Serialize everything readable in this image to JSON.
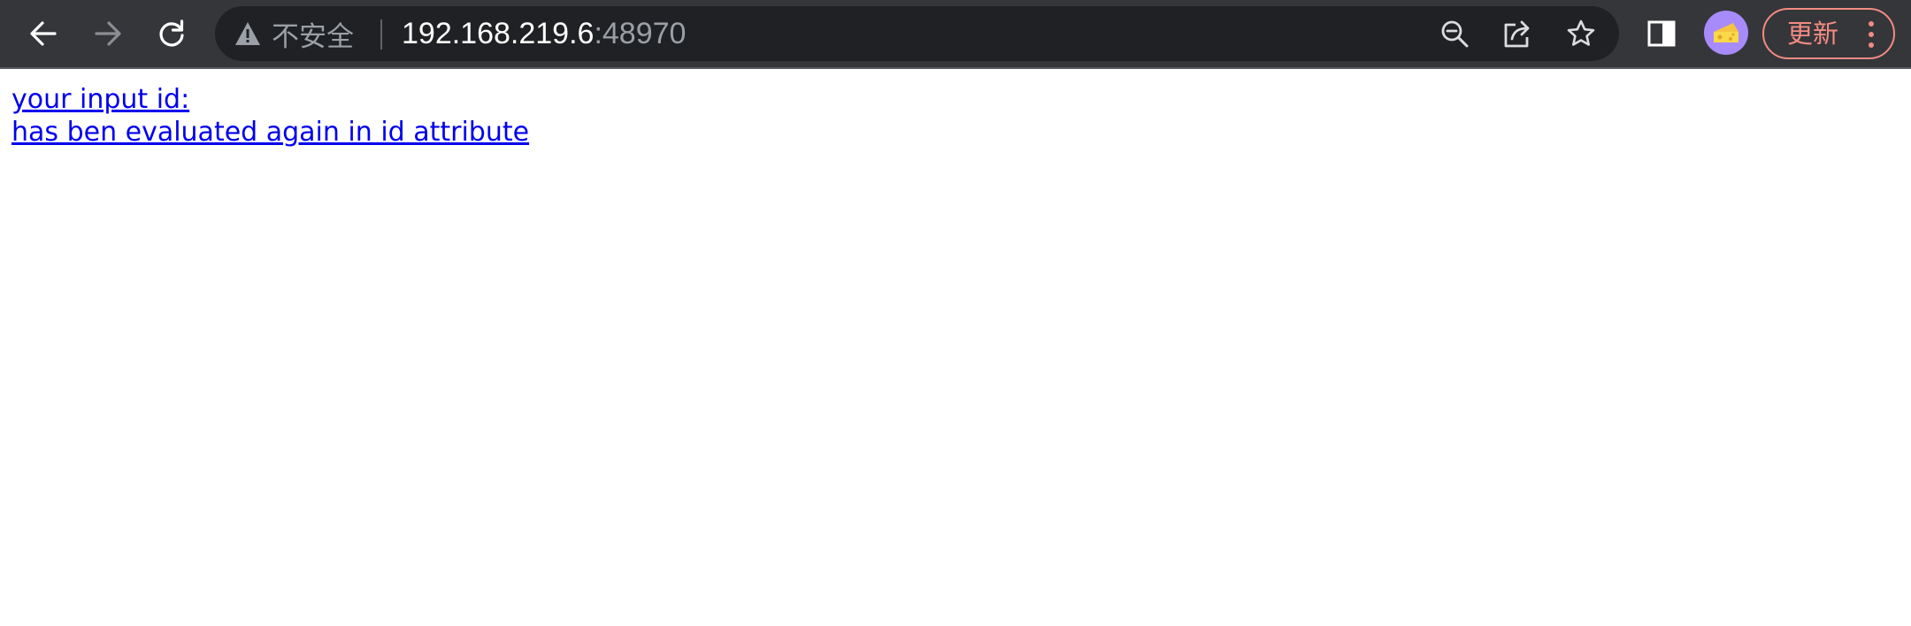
{
  "browser": {
    "nav": {
      "back_icon": "arrow-left-icon",
      "forward_icon": "arrow-right-icon",
      "reload_icon": "reload-icon"
    },
    "omnibox": {
      "security_icon": "warning-triangle-icon",
      "security_label": "不安全",
      "url_host": "192.168.219.6",
      "url_port": ":48970",
      "zoom_icon": "zoom-out-icon",
      "share_icon": "share-icon",
      "bookmark_icon": "star-icon"
    },
    "side_panel_icon": "side-panel-icon",
    "avatar_icon": "cheese-emoji-icon",
    "update_button_label": "更新",
    "menu_icon": "kebab-menu-icon",
    "colors": {
      "toolbar_bg": "#35363a",
      "omnibox_bg": "#202124",
      "url_host": "#ffffff",
      "url_muted": "#9aa0a6",
      "update_accent": "#f28b82",
      "avatar_bg": "#a78bfa"
    }
  },
  "page": {
    "lines": [
      "your input id:",
      "has ben evaluated again in id attribute"
    ],
    "link_color": "#0000ee"
  }
}
